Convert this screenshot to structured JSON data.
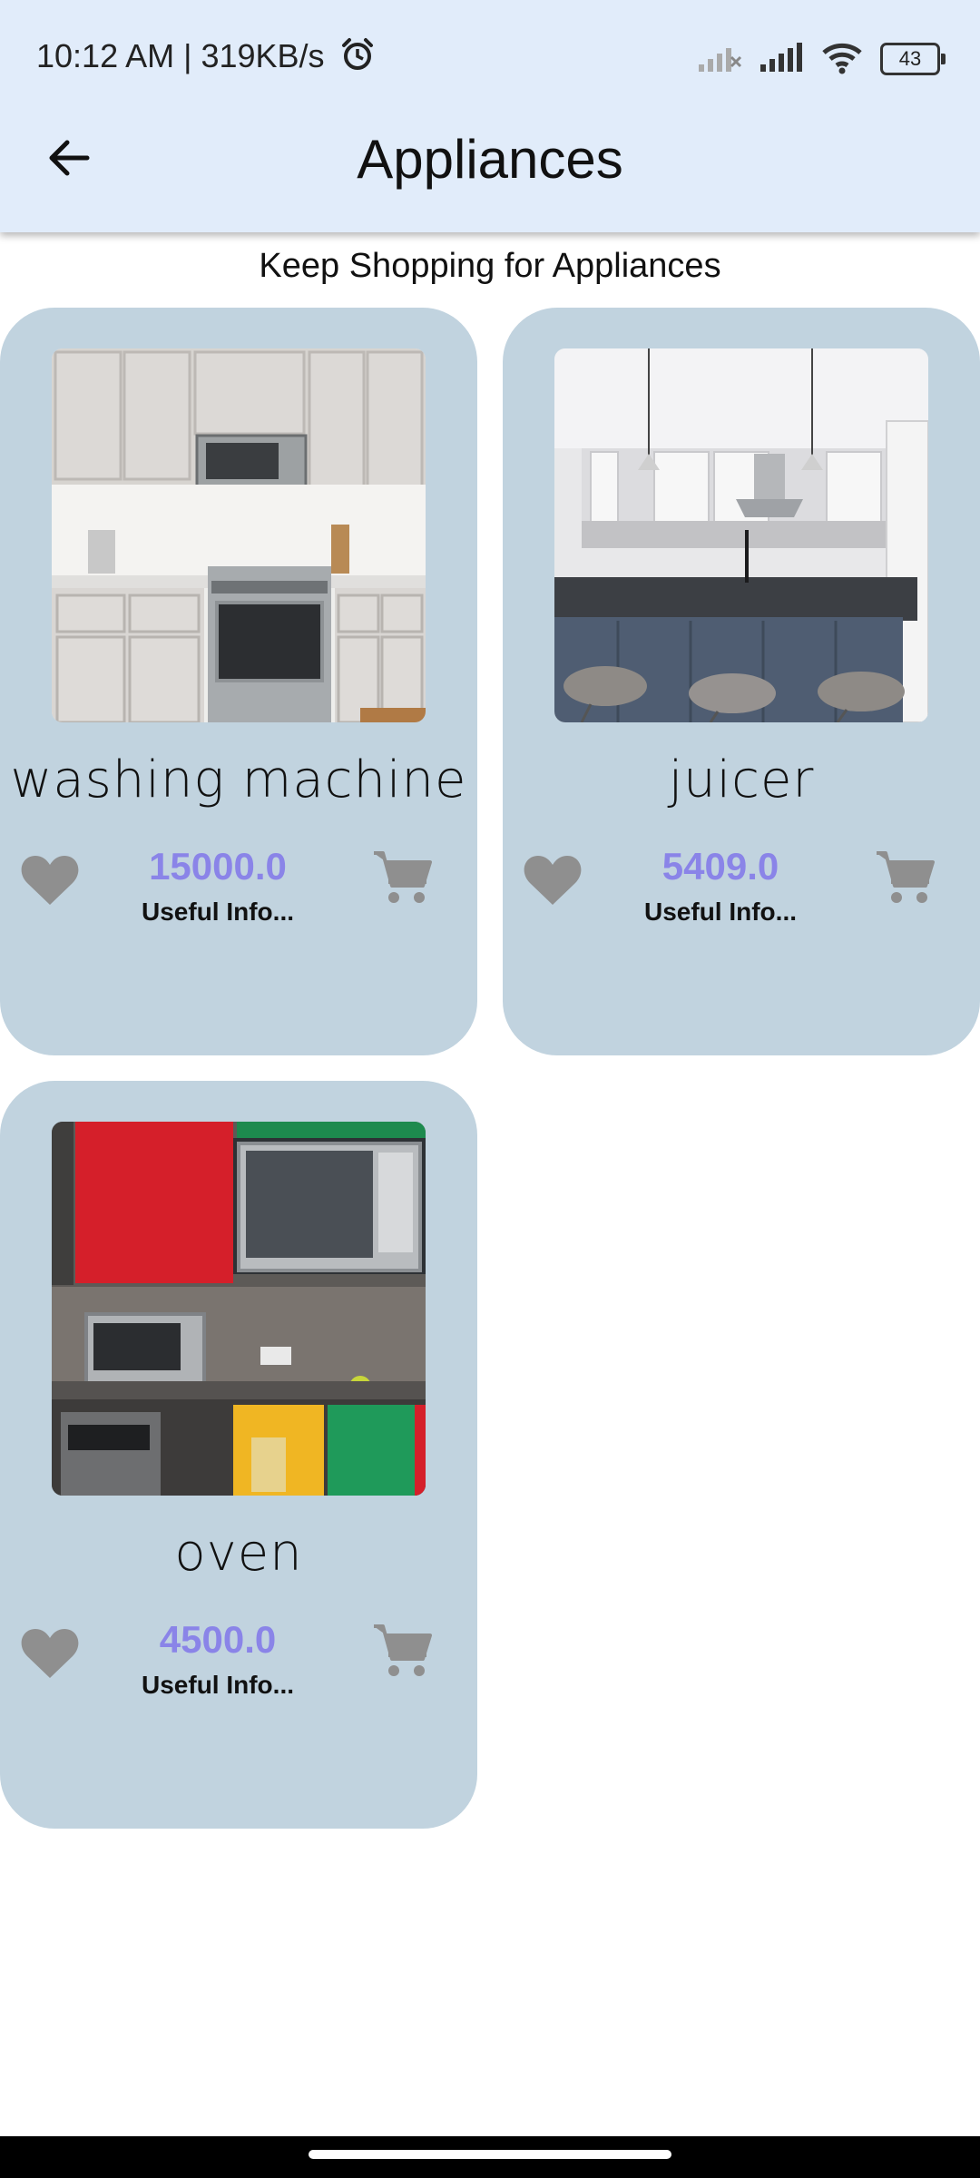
{
  "status_bar": {
    "time_speed": "10:12 AM | 319KB/s",
    "battery": "43",
    "icons": [
      "alarm-icon",
      "signal-off-icon",
      "signal-icon",
      "wifi-icon",
      "battery-icon"
    ]
  },
  "header": {
    "title": "Appliances",
    "back_icon": "arrow-left-icon"
  },
  "subtitle": "Keep Shopping for Appliances",
  "colors": {
    "appbar": "#e1ecfa",
    "card": "#c1d3df",
    "price": "#8a84e8",
    "icon": "#8f8f8f"
  },
  "products": [
    {
      "name": "washing machine",
      "price": "15000.0",
      "info": "Useful Info..."
    },
    {
      "name": "juicer",
      "price": "5409.0",
      "info": "Useful Info..."
    },
    {
      "name": "oven",
      "price": "4500.0",
      "info": "Useful Info..."
    }
  ]
}
